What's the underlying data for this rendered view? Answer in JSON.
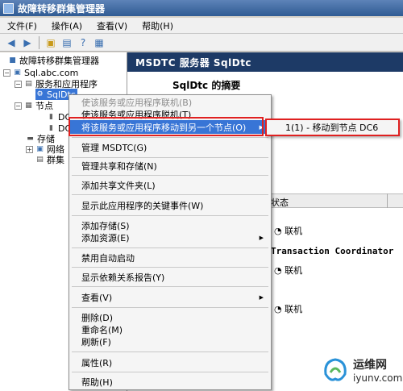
{
  "window": {
    "title": "故障转移群集管理器"
  },
  "menu": [
    "文件(F)",
    "操作(A)",
    "查看(V)",
    "帮助(H)"
  ],
  "tree": {
    "root": "故障转移群集管理器",
    "cluster": "Sql.abc.com",
    "services": "服务和应用程序",
    "selected": "SqlDtc",
    "nodes": "节点",
    "node1": "DC",
    "node2": "DC",
    "storage": "存储",
    "network": "网络",
    "events": "群集"
  },
  "right_pane": {
    "header": "MSDTC 服务器 SqlDtc",
    "summary": "SqlDtc 的摘要",
    "col_status": "状态",
    "row1_status": "联机",
    "row2_name": "Transaction Coordinator",
    "row3_status": "联机",
    "row4_status": "联机"
  },
  "context_menu": {
    "bring_online": "使该服务或应用程序联机(B)",
    "take_offline": "使该服务或应用程序脱机(T)",
    "move_to_node": "将该服务或应用程序移动到另一个节点(O)",
    "manage_msdtc": "管理 MSDTC(G)",
    "manage_share": "管理共享和存储(N)",
    "add_share": "添加共享文件夹(L)",
    "show_events": "显示此应用程序的关键事件(W)",
    "add_storage": "添加存储(S)",
    "add_resource": "添加资源(E)",
    "disable_autostart": "禁用自动启动",
    "show_dependency": "显示依赖关系报告(Y)",
    "view": "查看(V)",
    "delete": "删除(D)",
    "rename": "重命名(M)",
    "refresh": "刷新(F)",
    "properties": "属性(R)",
    "help": "帮助(H)"
  },
  "submenu": {
    "item1": "1(1) - 移动到节点 DC6"
  },
  "watermark": {
    "cn": "运维网",
    "en": "iyunv.com"
  },
  "colors": {
    "highlight": "#3875d6",
    "outline": "#e02020",
    "header": "#1d3a66"
  }
}
